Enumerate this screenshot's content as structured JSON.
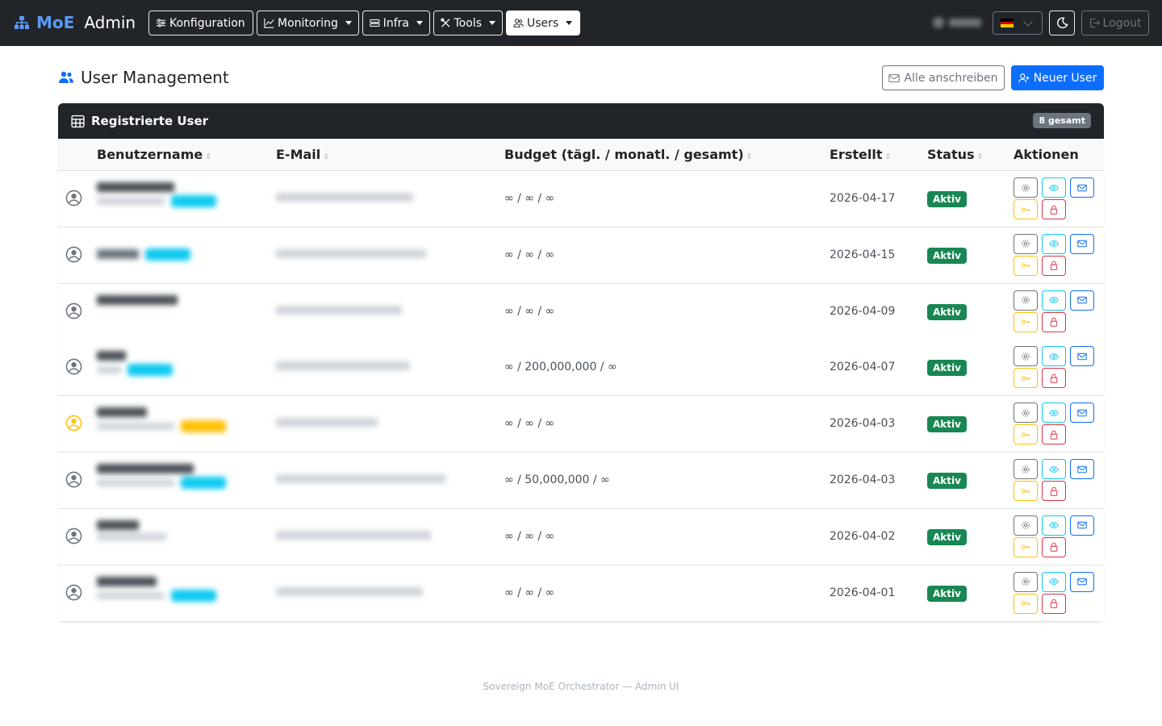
{
  "nav": {
    "brand_name": "MoE",
    "brand_suffix": "Admin",
    "menus": [
      {
        "label": "Konfiguration",
        "icon": "sliders-icon"
      },
      {
        "label": "Monitoring",
        "icon": "chart-line-icon"
      },
      {
        "label": "Infra",
        "icon": "server-icon"
      },
      {
        "label": "Tools",
        "icon": "tools-icon"
      },
      {
        "label": "Users",
        "icon": "users-icon"
      }
    ],
    "language_flag": "de",
    "logout_label": "Logout"
  },
  "header": {
    "title": "User Management",
    "mail_all_label": "Alle anschreiben",
    "new_user_label": "Neuer User"
  },
  "table": {
    "title": "Registrierte User",
    "count_label": "8 gesamt",
    "columns": {
      "username": "Benutzername",
      "email": "E-Mail",
      "budget": "Budget (tägl. / monatl. / gesamt)",
      "created": "Erstellt",
      "status": "Status",
      "actions": "Aktionen"
    },
    "rows": [
      {
        "budget": "∞ / ∞ / ∞",
        "created": "2026-04-17",
        "status": "Aktiv"
      },
      {
        "budget": "∞ / ∞ / ∞",
        "created": "2026-04-15",
        "status": "Aktiv"
      },
      {
        "budget": "∞ / ∞ / ∞",
        "created": "2026-04-09",
        "status": "Aktiv"
      },
      {
        "budget": "∞ / 200,000,000 / ∞",
        "created": "2026-04-07",
        "status": "Aktiv"
      },
      {
        "budget": "∞ / ∞ / ∞",
        "created": "2026-04-03",
        "status": "Aktiv"
      },
      {
        "budget": "∞ / 50,000,000 / ∞",
        "created": "2026-04-03",
        "status": "Aktiv"
      },
      {
        "budget": "∞ / ∞ / ∞",
        "created": "2026-04-02",
        "status": "Aktiv"
      },
      {
        "budget": "∞ / ∞ / ∞",
        "created": "2026-04-01",
        "status": "Aktiv"
      }
    ]
  },
  "footer": {
    "text": "Sovereign MoE Orchestrator — Admin UI"
  },
  "colors": {
    "navbar": "#212529",
    "brand": "#5b9bf8",
    "primary": "#0d6efd",
    "success": "#198754",
    "info": "#0dcaf0",
    "warning": "#ffc107",
    "danger": "#dc3545"
  }
}
